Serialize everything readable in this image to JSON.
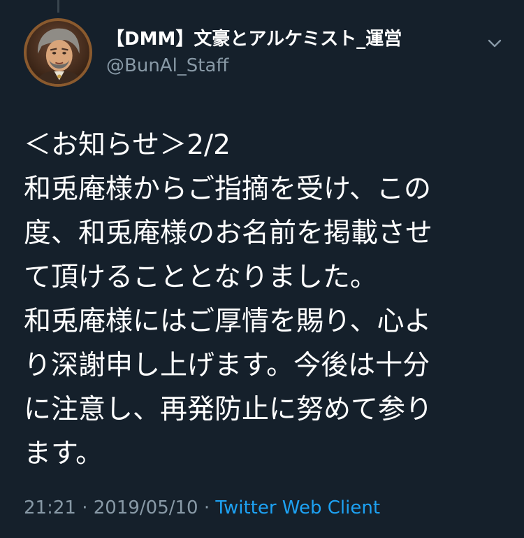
{
  "tweet": {
    "display_name": "【DMM】文豪とアルケミスト_運営",
    "handle": "@BunAl_Staff",
    "avatar_icon": "character-portrait-avatar",
    "menu_icon": "chevron-down-icon",
    "text_lines": [
      "＜お知らせ＞2/2",
      "和兎庵様からご指摘を受け、この",
      "度、和兎庵様のお名前を掲載させ",
      "て頂けることとなりました。",
      "和兎庵様にはご厚情を賜り、心よ",
      "り深謝申し上げます。今後は十分",
      "に注意し、再発防止に努めて参り",
      "ます。"
    ],
    "time": "21:21",
    "date": "2019/05/10",
    "separator": "·",
    "source": "Twitter Web Client"
  },
  "colors": {
    "background": "#15202b",
    "text_primary": "#ffffff",
    "text_secondary": "#8899a6",
    "link": "#1da1f2"
  }
}
